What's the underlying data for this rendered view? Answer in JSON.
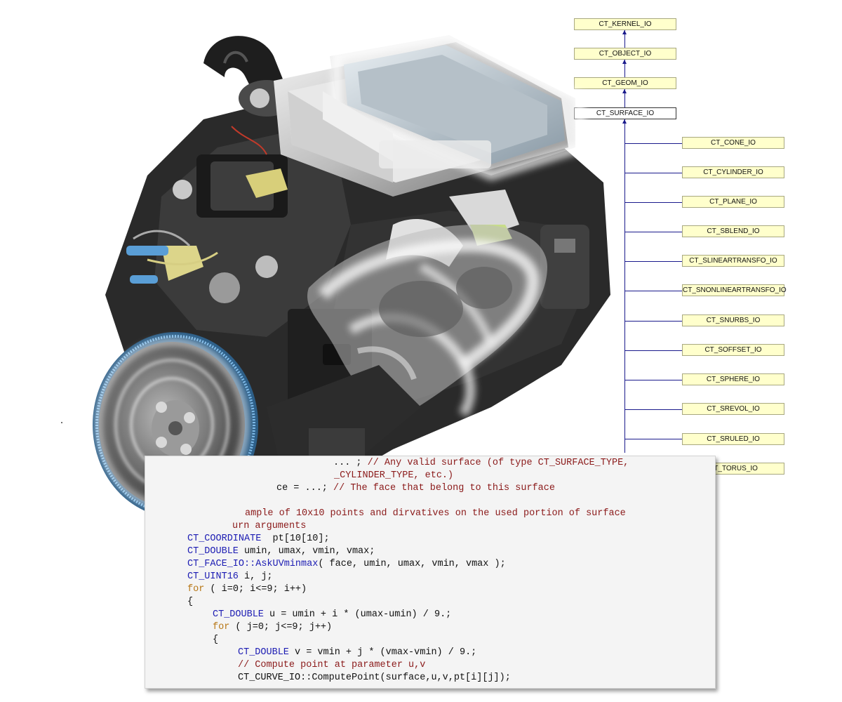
{
  "hierarchy": {
    "base_chain": [
      "CT_KERNEL_IO",
      "CT_OBJECT_IO",
      "CT_GEOM_IO",
      "CT_SURFACE_IO"
    ],
    "active_class": "CT_SURFACE_IO",
    "children": [
      "CT_CONE_IO",
      "CT_CYLINDER_IO",
      "CT_PLANE_IO",
      "CT_SBLEND_IO",
      "CT_SLINEARTRANSFO_IO",
      "CT_SNONLINEARTRANSFO_IO",
      "CT_SNURBS_IO",
      "CT_SOFFSET_IO",
      "CT_SPHERE_IO",
      "CT_SREVOL_IO",
      "CT_SRULED_IO",
      "CT_TORUS_IO"
    ]
  },
  "code": {
    "l1": {
      "text": "... ; ",
      "comment": "// Any valid surface (of type CT_SURFACE_TYPE,"
    },
    "l2": {
      "comment": "_CYLINDER_TYPE, etc.)"
    },
    "l3": {
      "text": "ce = ...; ",
      "comment": "// The face that belong to this surface"
    },
    "l4": {
      "comment": "ample of 10x10 points and dirvatives on the used portion of surface"
    },
    "l5": {
      "comment": "urn arguments"
    },
    "l6": {
      "type": "CT_COORDINATE",
      "text": "  pt[10[10];"
    },
    "l7": {
      "type": "CT_DOUBLE",
      "text": " umin, umax, vmin, vmax;"
    },
    "l8": {
      "type": "CT_FACE_IO::AskUVminmax",
      "text": "( face, umin, umax, vmin, vmax );"
    },
    "l9": {
      "type": "CT_UINT16",
      "text": " i, j;"
    },
    "l10": {
      "keyword": "for",
      "text": " ( i=0; i<=9; i++)"
    },
    "l11": {
      "text": "{"
    },
    "l12": {
      "type": "CT_DOUBLE",
      "text": " u = umin + i * (umax-umin) / 9.;"
    },
    "l13": {
      "keyword": "for",
      "text": " ( j=0; j<=9; j++)"
    },
    "l14": {
      "text": "{"
    },
    "l15": {
      "type": "CT_DOUBLE",
      "text": " v = vmin + j * (vmax-vmin) / 9.;"
    },
    "l16": {
      "comment": "// Compute point at parameter u,v"
    },
    "l17": {
      "text": "CT_CURVE_IO::ComputePoint(surface,u,v,pt[i][j]);"
    }
  },
  "colors": {
    "node_fill": "#ffffcc",
    "connector": "#1a1a8c",
    "comment": "#8b1a1a",
    "type": "#1c1cb3",
    "keyword": "#b77716"
  },
  "icons": {
    "engine": "engine-illustration-icon"
  }
}
